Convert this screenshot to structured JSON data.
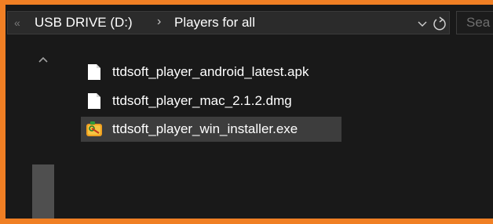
{
  "breadcrumb": {
    "overflow_glyph": "«",
    "drive": "USB DRIVE (D:)",
    "separator": "›",
    "folder": "Players for all"
  },
  "search": {
    "placeholder": "Sea"
  },
  "files": [
    {
      "name": "ttdsoft_player_android_latest.apk",
      "icon": "blank-file-icon",
      "selected": false
    },
    {
      "name": "ttdsoft_player_mac_2.1.2.dmg",
      "icon": "blank-file-icon",
      "selected": false
    },
    {
      "name": "ttdsoft_player_win_installer.exe",
      "icon": "installer-icon",
      "selected": true
    }
  ],
  "colors": {
    "frame": "#f07f24",
    "background": "#191919",
    "selection": "#3d3d3d"
  }
}
